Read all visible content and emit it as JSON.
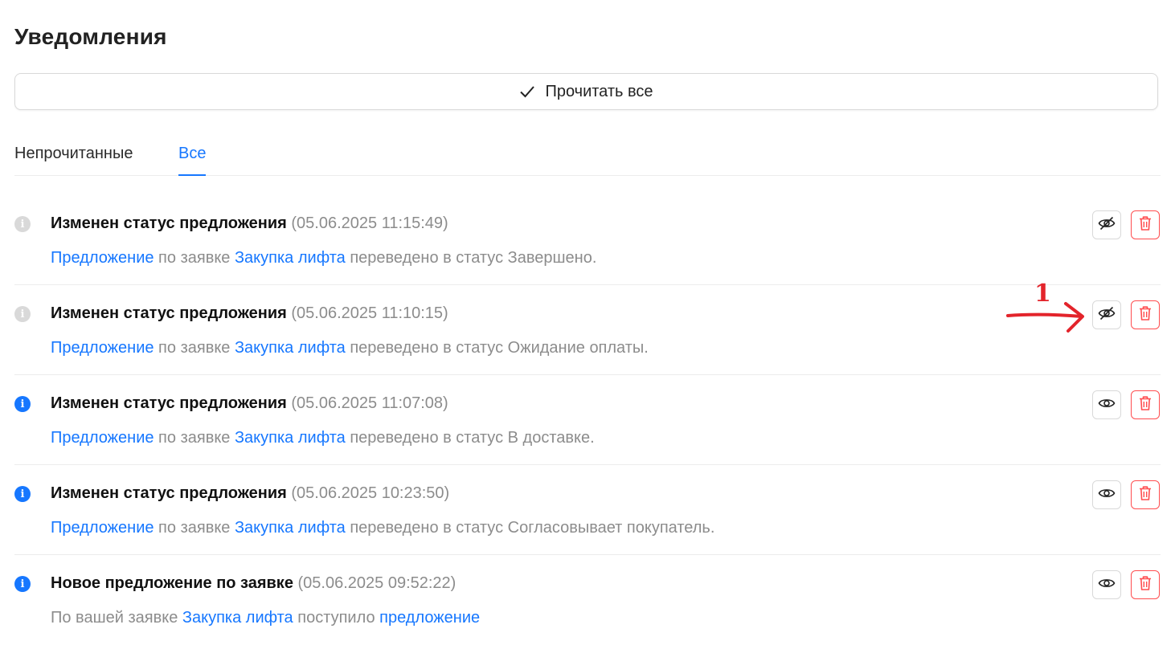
{
  "page": {
    "title": "Уведомления"
  },
  "toolbar": {
    "read_all_label": "Прочитать все",
    "read_all_icon": "check-icon"
  },
  "tabs": [
    {
      "label": "Непрочитанные",
      "active": false
    },
    {
      "label": "Все",
      "active": true
    }
  ],
  "colors": {
    "accent": "#1677ff",
    "danger": "#ff4d4f",
    "muted": "#8c8c8c",
    "annotation": "#e3242b"
  },
  "notifications": [
    {
      "title": "Изменен статус предложения",
      "timestamp": "(05.06.2025 11:15:49)",
      "read": true,
      "toggle_icon": "eye-slash-icon",
      "message": {
        "link1": "Предложение",
        "text1": " по заявке ",
        "link2": "Закупка лифта",
        "text2": " переведено в статус Завершено."
      }
    },
    {
      "title": "Изменен статус предложения",
      "timestamp": "(05.06.2025 11:10:15)",
      "read": true,
      "toggle_icon": "eye-slash-icon",
      "message": {
        "link1": "Предложение",
        "text1": " по заявке ",
        "link2": "Закупка лифта",
        "text2": " переведено в статус Ожидание оплаты."
      }
    },
    {
      "title": "Изменен статус предложения",
      "timestamp": "(05.06.2025 11:07:08)",
      "read": false,
      "toggle_icon": "eye-icon",
      "message": {
        "link1": "Предложение",
        "text1": " по заявке ",
        "link2": "Закупка лифта",
        "text2": " переведено в статус В доставке."
      }
    },
    {
      "title": "Изменен статус предложения",
      "timestamp": "(05.06.2025 10:23:50)",
      "read": false,
      "toggle_icon": "eye-icon",
      "message": {
        "link1": "Предложение",
        "text1": " по заявке ",
        "link2": "Закупка лифта",
        "text2": " переведено в статус Согласовывает покупатель."
      }
    },
    {
      "title": "Новое предложение по заявке",
      "timestamp": "(05.06.2025 09:52:22)",
      "read": false,
      "toggle_icon": "eye-icon",
      "message": {
        "text0": "По вашей заявке ",
        "link2": "Закупка лифта",
        "text2": " поступило ",
        "link3": "предложение"
      }
    }
  ],
  "annotation": {
    "label": "1"
  }
}
